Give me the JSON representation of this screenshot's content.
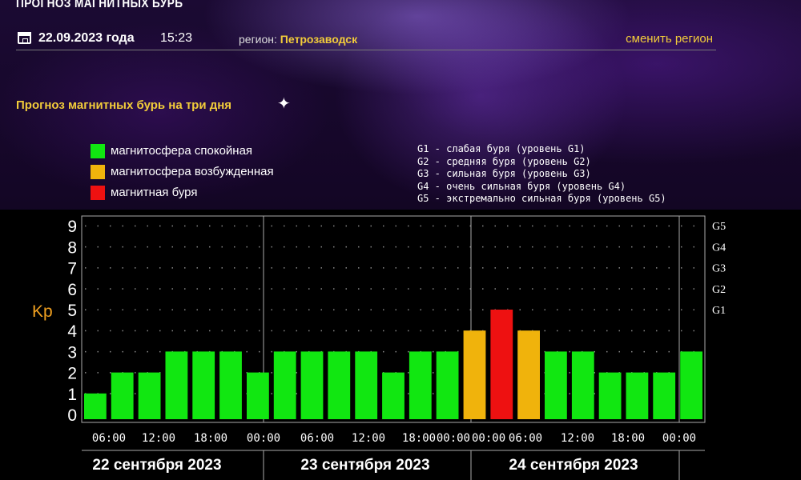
{
  "header": {
    "title": "ПРОГНОЗ МАГНИТНЫХ БУРЬ",
    "date": "22.09.2023 года",
    "time": "15:23",
    "region_label": "регион:",
    "region_value": "Петрозаводск",
    "change_region": "сменить регион"
  },
  "section_title": "Прогноз магнитных бурь на три дня",
  "legend": [
    {
      "label": "магнитосфера спокойная",
      "color": "#11e711"
    },
    {
      "label": "магнитосфера возбужденная",
      "color": "#f0b30c"
    },
    {
      "label": "магнитная буря",
      "color": "#ee1111"
    }
  ],
  "g_levels": [
    "G1 - слабая буря (уровень G1)",
    "G2 - средняя буря (уровень G2)",
    "G3 - сильная буря (уровень G3)",
    "G4 - очень сильная буря (уровень G4)",
    "G5 - экстремально сильная буря (уровень G5)"
  ],
  "chart_data": {
    "type": "bar",
    "ylabel": "Kp",
    "ylim": [
      0,
      9
    ],
    "yticks": [
      0,
      1,
      2,
      3,
      4,
      5,
      6,
      7,
      8,
      9
    ],
    "right_ticks": [
      {
        "value": 5,
        "label": "G1"
      },
      {
        "value": 6,
        "label": "G2"
      },
      {
        "value": 7,
        "label": "G3"
      },
      {
        "value": 8,
        "label": "G4"
      },
      {
        "value": 9,
        "label": "G5"
      }
    ],
    "time_labels": [
      "06:00",
      "12:00",
      "18:00",
      "00:00",
      "06:00",
      "12:00",
      "18:00",
      "00:00",
      "00:00",
      "06:00",
      "12:00",
      "18:00",
      "00:00"
    ],
    "days": [
      "22 сентября 2023",
      "23 сентября 2023",
      "24 сентября 2023"
    ],
    "values": [
      1,
      2,
      2,
      3,
      3,
      3,
      2,
      3,
      3,
      3,
      3,
      2,
      3,
      3,
      4,
      5,
      4,
      3,
      3,
      2,
      2,
      2,
      3
    ],
    "color_rules": {
      "calm_max": 3,
      "excited": 4,
      "storm_min": 5
    },
    "colors": {
      "calm": "#11e711",
      "excited": "#f0b30c",
      "storm": "#ee1111"
    },
    "grid": true
  }
}
